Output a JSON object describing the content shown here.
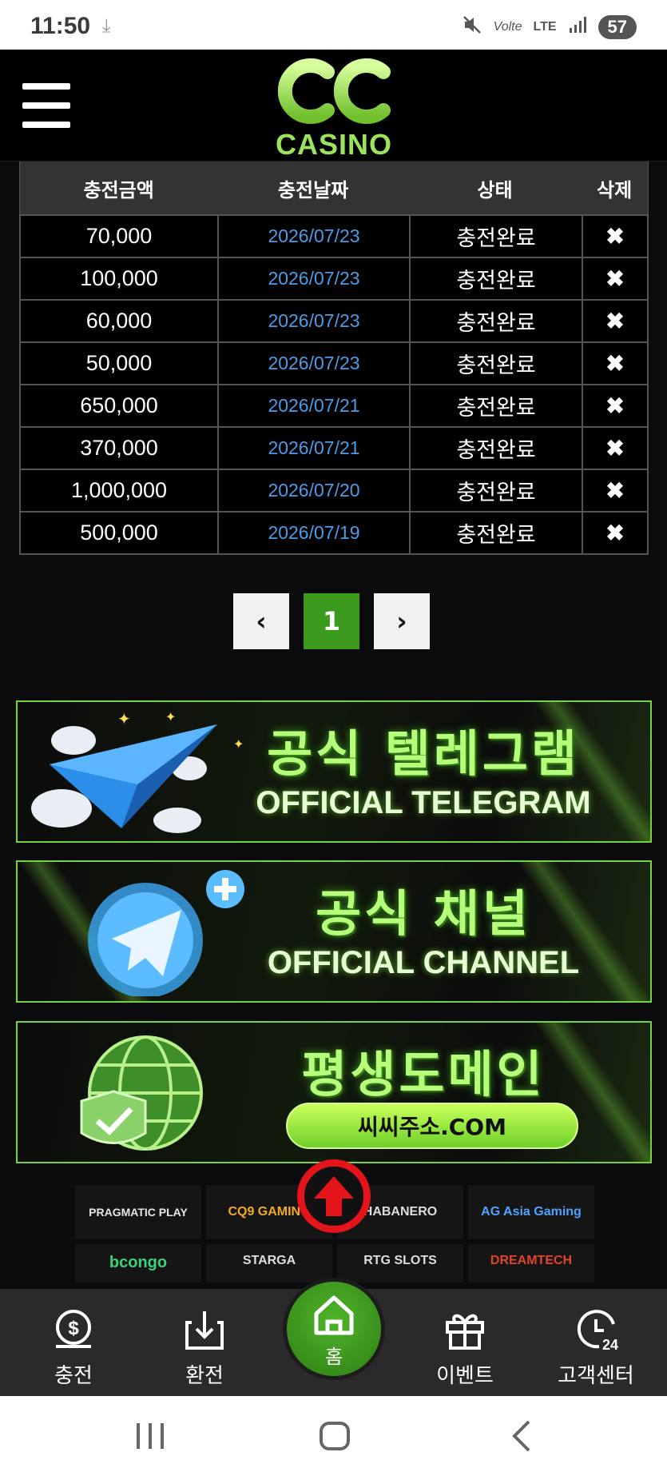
{
  "status_bar": {
    "time": "11:50",
    "download_icon": "download-arrow-icon",
    "icons": [
      "mute-icon",
      "volte-icon",
      "lte-icon",
      "signal-icon"
    ],
    "volte_label": "Volte",
    "lte_label": "LTE",
    "battery": "57"
  },
  "header": {
    "menu_icon": "hamburger-icon",
    "logo_text": "CASINO"
  },
  "table": {
    "columns": [
      "충전금액",
      "충전날짜",
      "상태",
      "삭제"
    ],
    "rows": [
      {
        "amount": "70,000",
        "date": "2026/07/23",
        "status": "충전완료",
        "delete": "✖"
      },
      {
        "amount": "100,000",
        "date": "2026/07/23",
        "status": "충전완료",
        "delete": "✖"
      },
      {
        "amount": "60,000",
        "date": "2026/07/23",
        "status": "충전완료",
        "delete": "✖"
      },
      {
        "amount": "50,000",
        "date": "2026/07/23",
        "status": "충전완료",
        "delete": "✖"
      },
      {
        "amount": "650,000",
        "date": "2026/07/21",
        "status": "충전완료",
        "delete": "✖"
      },
      {
        "amount": "370,000",
        "date": "2026/07/21",
        "status": "충전완료",
        "delete": "✖"
      },
      {
        "amount": "1,000,000",
        "date": "2026/07/20",
        "status": "충전완료",
        "delete": "✖"
      },
      {
        "amount": "500,000",
        "date": "2026/07/19",
        "status": "충전완료",
        "delete": "✖"
      }
    ]
  },
  "pagination": {
    "prev": "‹",
    "current": "1",
    "next": "›"
  },
  "banners": {
    "telegram": {
      "title": "공식 텔레그램",
      "subtitle": "OFFICIAL TELEGRAM"
    },
    "channel": {
      "title": "공식 채널",
      "subtitle": "OFFICIAL CHANNEL"
    },
    "domain": {
      "title": "평생도메인",
      "button": "씨씨주소.COM"
    }
  },
  "providers": {
    "row1": [
      "PRAGMATIC PLAY",
      "CQ9 GAMING",
      "HABANERO",
      "AG Asia Gaming"
    ],
    "row2": [
      "bcongo",
      "STARGA",
      "RTG SLOTS",
      "DREAMTECH"
    ]
  },
  "bottom_nav": {
    "deposit": "충전",
    "withdraw": "환전",
    "home": "홈",
    "event": "이벤트",
    "support": "고객센터"
  },
  "colors": {
    "accent_green": "#3c9a1e",
    "date_blue": "#4d9be6",
    "scroll_top_red": "#e3141a",
    "banner_border": "#77d23b"
  }
}
